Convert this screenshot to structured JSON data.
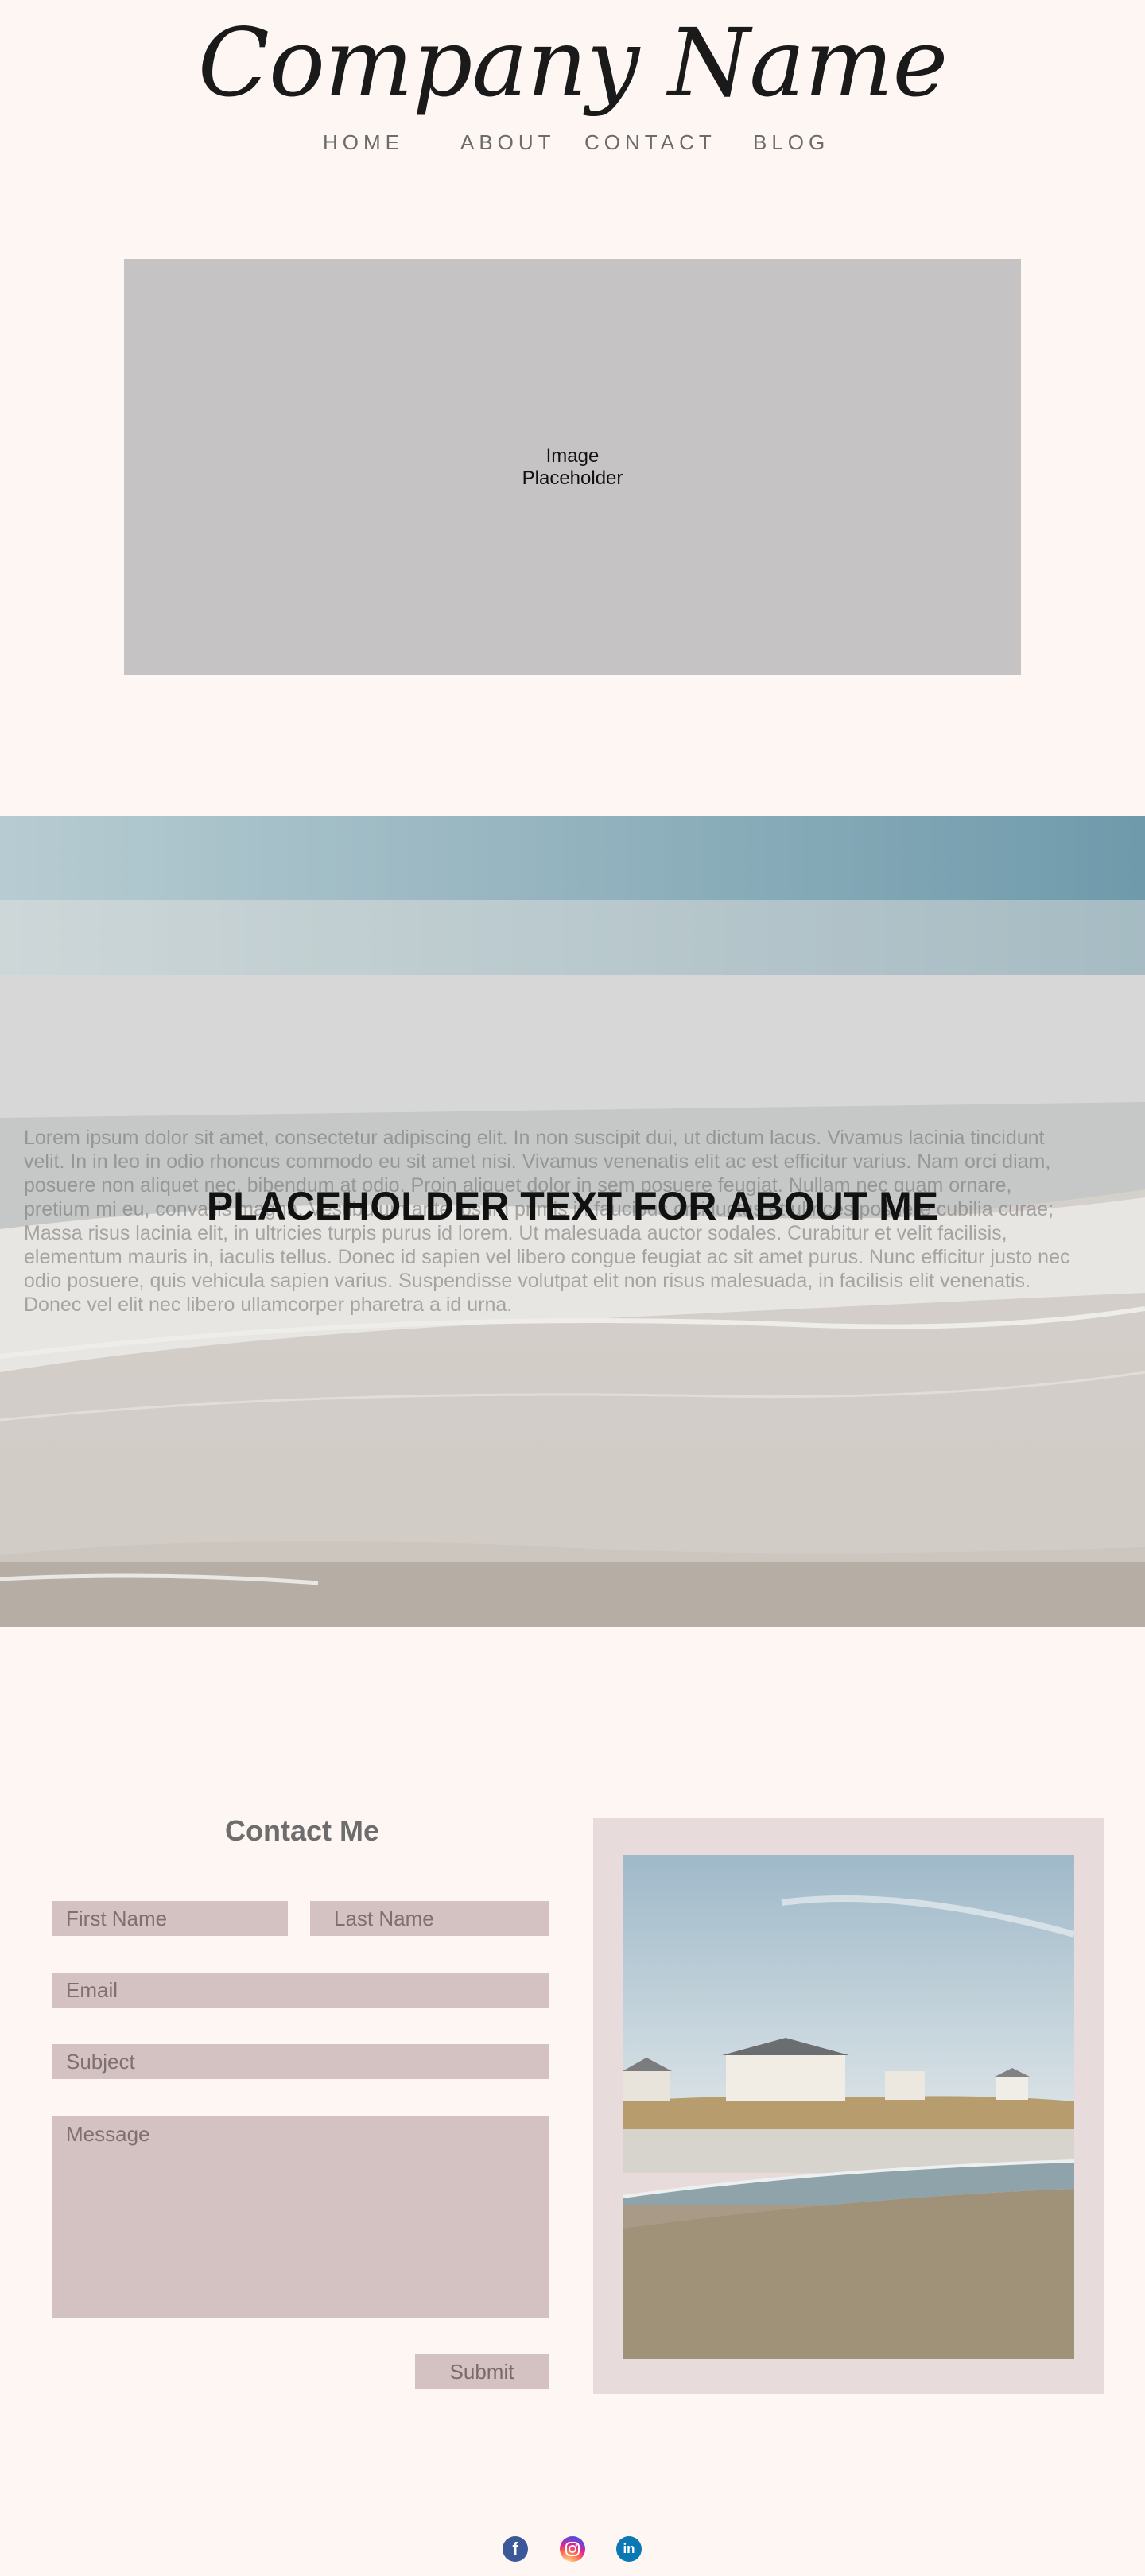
{
  "header": {
    "logo_text": "Company Name",
    "nav": [
      {
        "label": "HOME"
      },
      {
        "label": "ABOUT"
      },
      {
        "label": "CONTACT"
      },
      {
        "label": "BLOG"
      }
    ]
  },
  "hero": {
    "placeholder_line1": "Image",
    "placeholder_line2": "Placeholder"
  },
  "about": {
    "title": "PLACEHOLDER TEXT FOR ABOUT ME",
    "body": "Lorem ipsum dolor sit amet, consectetur adipiscing elit. In non suscipit dui, ut dictum lacus. Vivamus lacinia tincidunt velit. In in leo in odio rhoncus commodo eu sit amet nisi. Vivamus venenatis elit ac est efficitur varius. Nam orci diam, posuere non aliquet nec, bibendum at odio. Proin aliquet dolor in sem posuere feugiat. Nullam nec quam ornare, pretium mi eu, convallis magna. Vestibulum ante ipsum primis in faucibus orci luctus et ultrices posuere cubilia curae; Massa risus lacinia elit, in ultricies turpis purus id lorem. Ut malesuada auctor sodales. Curabitur et velit facilisis, elementum mauris in, iaculis tellus. Donec id sapien vel libero congue feugiat ac sit amet purus. Nunc efficitur justo nec odio posuere, quis vehicula sapien varius. Suspendisse volutpat elit non risus malesuada, in facilisis elit venenatis. Donec vel elit nec libero ullamcorper pharetra a id urna."
  },
  "contact": {
    "title": "Contact Me",
    "first_name_placeholder": "First Name",
    "last_name_placeholder": "Last Name",
    "email_placeholder": "Email",
    "subject_placeholder": "Subject",
    "message_placeholder": "Message",
    "submit_label": "Submit"
  },
  "social": [
    {
      "icon": "facebook-icon",
      "glyph": "f"
    },
    {
      "icon": "instagram-icon",
      "glyph": ""
    },
    {
      "icon": "linkedin-icon",
      "glyph": "in"
    }
  ],
  "colors": {
    "background": "#fdf6f3",
    "field": "#d4c2c3",
    "placeholder_box": "#c5c3c3",
    "photo_frame": "#e8dbdb"
  }
}
